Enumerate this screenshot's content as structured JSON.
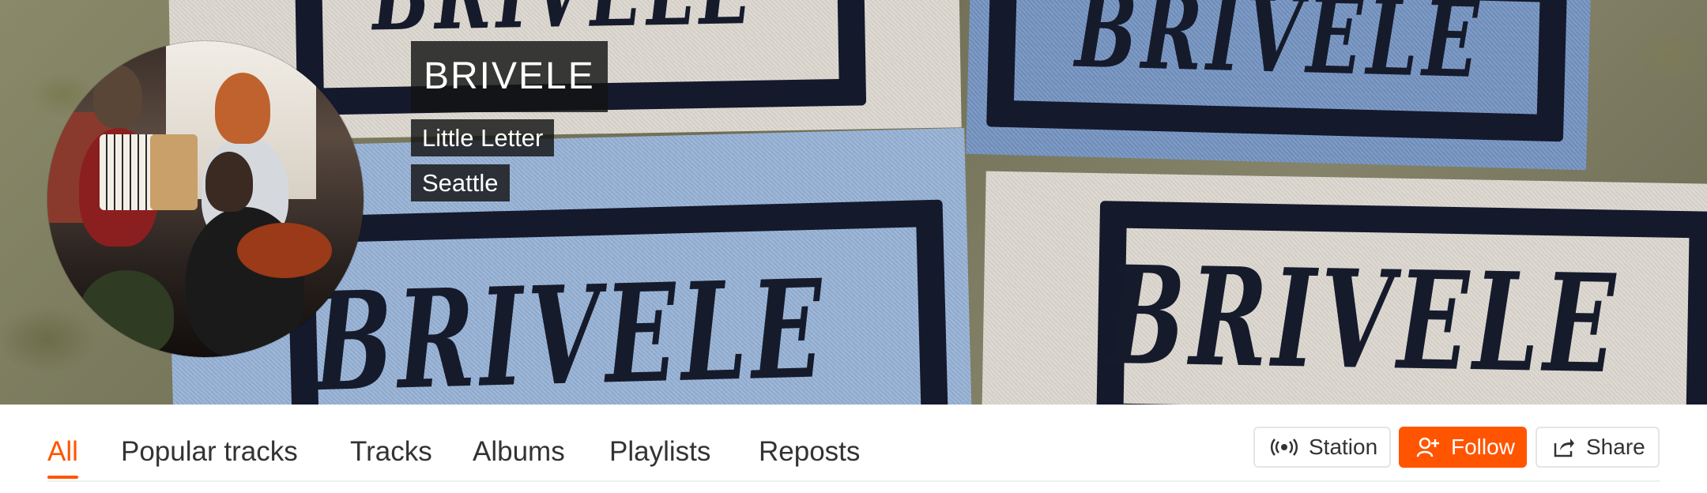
{
  "profile": {
    "name": "BRIVELE",
    "subtitle": "Little Letter",
    "city": "Seattle",
    "banner_word": "BRIVELE"
  },
  "tabs": [
    {
      "label": "All",
      "active": true
    },
    {
      "label": "Popular tracks",
      "active": false
    },
    {
      "label": "Tracks",
      "active": false
    },
    {
      "label": "Albums",
      "active": false
    },
    {
      "label": "Playlists",
      "active": false
    },
    {
      "label": "Reposts",
      "active": false
    }
  ],
  "actions": {
    "station_label": "Station",
    "follow_label": "Follow",
    "share_label": "Share"
  },
  "colors": {
    "accent": "#ff5500",
    "tab_text": "#333333",
    "label_bg": "#141414"
  },
  "icons": {
    "station": "station-broadcast-icon",
    "follow": "add-user-icon",
    "share": "share-icon"
  }
}
